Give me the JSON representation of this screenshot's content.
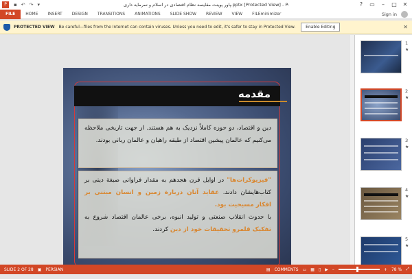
{
  "window": {
    "title": "پاور پوینت مقایسه نظام اقتصادی در اسلام و سرمایه داری.pptx [Protected View] - PowerPoint",
    "app_icon": "P"
  },
  "ribbon": {
    "file": "FILE",
    "tabs": [
      "HOME",
      "INSERT",
      "DESIGN",
      "TRANSITIONS",
      "ANIMATIONS",
      "SLIDE SHOW",
      "REVIEW",
      "VIEW",
      "FILEminimizer"
    ],
    "sign_in": "Sign in"
  },
  "protected_view": {
    "label": "PROTECTED VIEW",
    "message": "Be careful—files from the Internet can contain viruses. Unless you need to edit, it's safer to stay in Protected View.",
    "button": "Enable Editing"
  },
  "slide": {
    "title": "مقدمه",
    "para1": "دین و اقتصاد، دو حوزه کاملاً نزدیک به هم هستند. از جهت تاریخی ملاحظه می‌کنیم که عالمان پیشین اقتصاد از طبقه راهبان و عالمان ربانی بودند.",
    "p2_accent1": "\"فیزیوکرات‌ها\"",
    "p2_text1": " در اوایل قرن هجدهم به مقدار فراوانی صبغة دینی بر کتاب‌هایشان دادند. ",
    "p2_accent2": "عقاید آنان دربارة زمین و انسان مبتنی بر افکار مسیحیت بود.",
    "p3_text1": "با حدوث انقلاب صنعتی و تولید انبوه، برخی عالمان اقتصاد شروع به ",
    "p3_accent": "تفکیک قلمرو تحقیقات خود از دین",
    "p3_text2": " کردند."
  },
  "thumbnails": [
    {
      "num": "1",
      "star": "★"
    },
    {
      "num": "2",
      "star": "★"
    },
    {
      "num": "3",
      "star": "★"
    },
    {
      "num": "4",
      "star": "★"
    },
    {
      "num": "5",
      "star": "★"
    }
  ],
  "status": {
    "slide_of": "SLIDE 2 OF 28",
    "language": "PERSIAN",
    "comments": "COMMENTS",
    "zoom": "78 %"
  }
}
